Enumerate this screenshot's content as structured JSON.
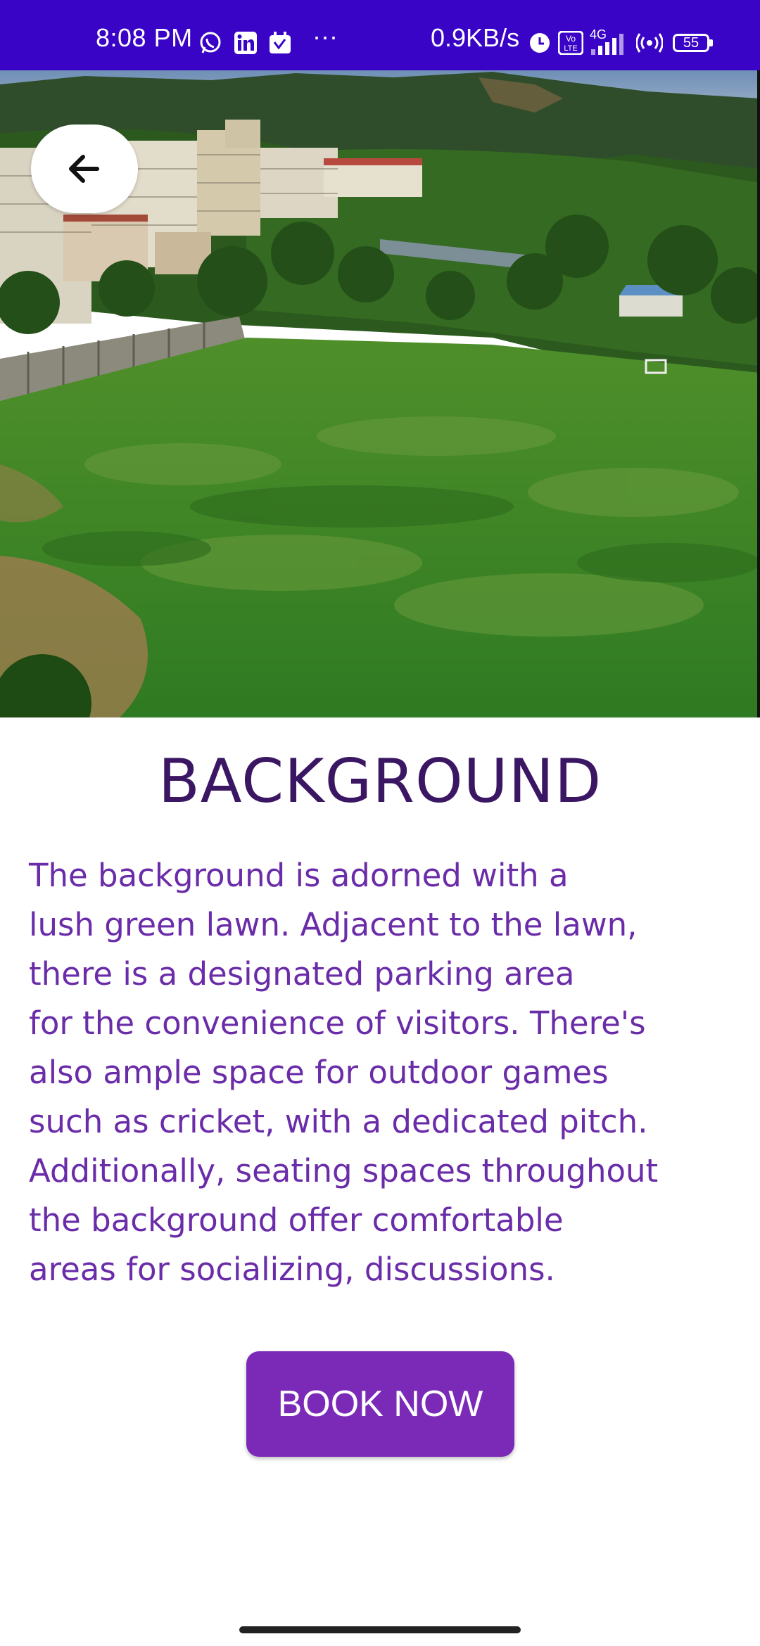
{
  "status_bar": {
    "time": "8:08 PM",
    "more_dots": "···",
    "network_speed": "0.9KB/s",
    "network_type": "4G",
    "volte_label": "Vo LTE",
    "battery_level": "55",
    "background_color": "#3a04c6",
    "icons": [
      "whatsapp-icon",
      "linkedin-icon",
      "app-notification-icon",
      "alarm-icon",
      "volte-icon",
      "signal-icon",
      "hotspot-icon",
      "battery-icon"
    ]
  },
  "hero": {
    "image_subject": "college campus with green lawn and buildings",
    "back_icon": "arrow-left-icon"
  },
  "content": {
    "title": "BACKGROUND",
    "description_lines": [
      "The background is adorned with a",
      "lush green lawn. Adjacent to the lawn,",
      "there is a designated parking area",
      "for the convenience of visitors. There's",
      "also ample space for outdoor games",
      "such as cricket, with a dedicated pitch.",
      "Additionally, seating spaces throughout",
      "the background offer comfortable",
      "areas for socializing, discussions."
    ],
    "title_color": "#3b1763",
    "text_color": "#6a2ca8"
  },
  "actions": {
    "book_label": "BOOK NOW",
    "button_color": "#7b2ab8"
  }
}
